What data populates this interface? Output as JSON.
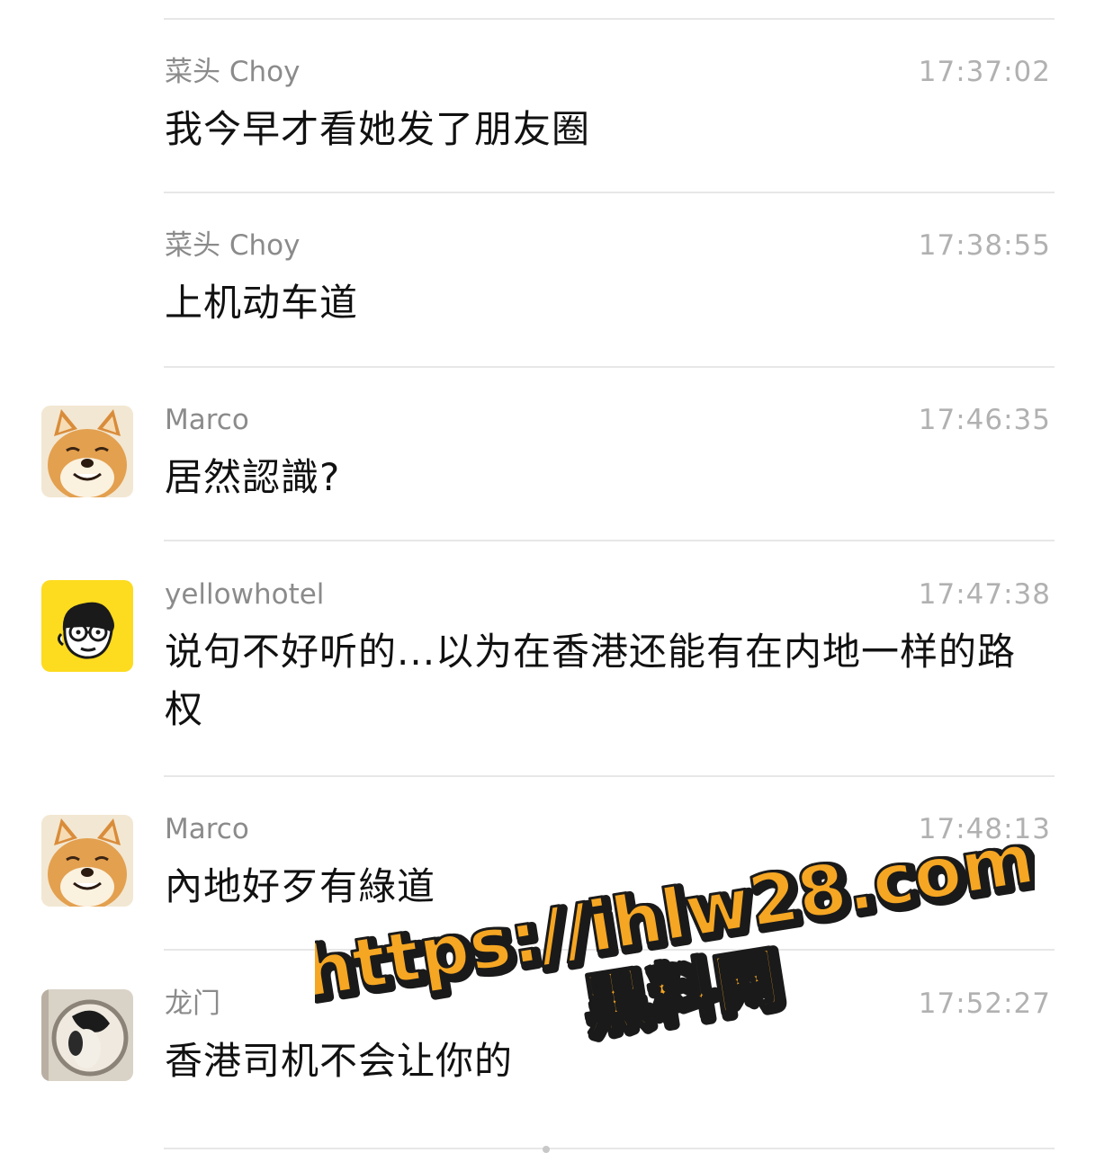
{
  "messages": [
    {
      "sender": "菜头 Choy",
      "time": "17:37:02",
      "text": "我今早才看她发了朋友圈",
      "avatar": ""
    },
    {
      "sender": "菜头 Choy",
      "time": "17:38:55",
      "text": "上机动车道",
      "avatar": ""
    },
    {
      "sender": "Marco",
      "time": "17:46:35",
      "text": "居然認識?",
      "avatar": "shiba-dog-avatar"
    },
    {
      "sender": "yellowhotel",
      "time": "17:47:38",
      "text": "说句不好听的...以为在香港还能有在内地一样的路权",
      "avatar": "cartoon-face-with-glasses-avatar"
    },
    {
      "sender": "Marco",
      "time": "17:48:13",
      "text": "內地好歹有綠道",
      "avatar": "shiba-dog-avatar"
    },
    {
      "sender": "龙门",
      "time": "17:52:27",
      "text": "香港司机不会让你的",
      "avatar": "round-mirror-photo-avatar"
    }
  ],
  "watermark": {
    "url_text": "https://ihlw28.com",
    "site_text": "黑料网",
    "fill_color": "#f5a623",
    "outline_color": "#1a1a1a"
  },
  "colors": {
    "sender": "#8b8b8b",
    "time": "#b1b1b1",
    "message": "#111111",
    "divider": "#e7e7e7",
    "yellow_avatar_bg": "#fddb1f"
  }
}
